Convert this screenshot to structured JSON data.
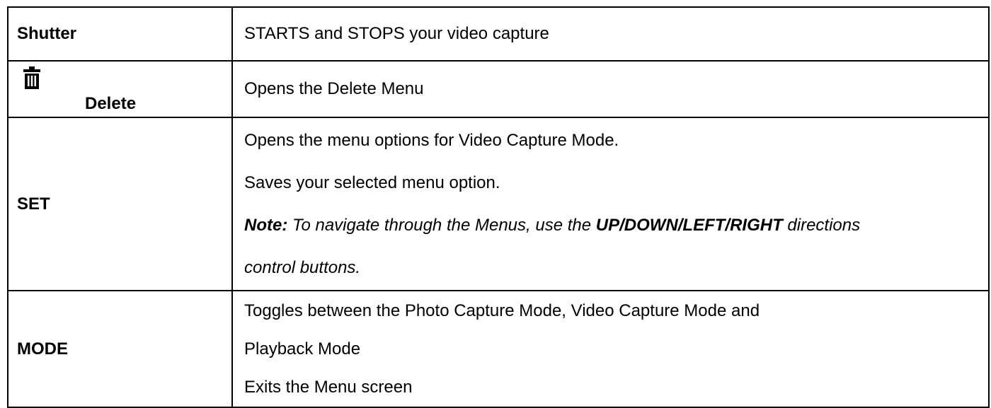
{
  "rows": [
    {
      "key": "Shutter",
      "lines": [
        "STARTS and STOPS your video capture"
      ]
    },
    {
      "key": "Delete",
      "icon": "trash-icon",
      "lines": [
        "Opens the Delete Menu"
      ]
    },
    {
      "key": "SET",
      "lines": [
        "Opens the menu options for Video Capture Mode.",
        "Saves your selected menu option."
      ],
      "note": {
        "label": "Note:",
        "before": " To navigate through the Menus, use the ",
        "emphasis": "UP/DOWN/LEFT/RIGHT",
        "after": " directions",
        "continued": "control buttons."
      }
    },
    {
      "key": "MODE",
      "lines": [
        "Toggles between the Photo Capture Mode, Video Capture Mode and",
        "Playback Mode",
        "Exits the Menu screen"
      ]
    }
  ]
}
